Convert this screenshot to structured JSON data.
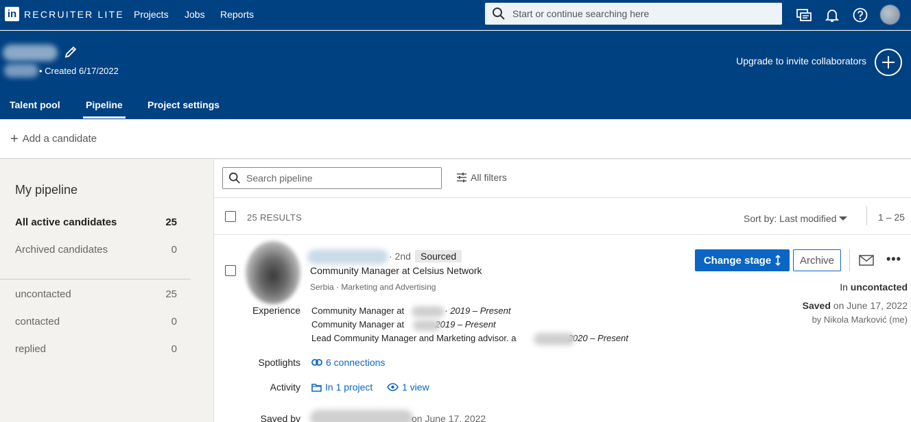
{
  "app": {
    "brand": "RECRUITER LITE",
    "logo_letters": "in"
  },
  "nav": {
    "links": [
      "Projects",
      "Jobs",
      "Reports"
    ],
    "search_placeholder": "Start or continue searching here"
  },
  "project": {
    "created": "• Created 6/17/2022",
    "upgrade_label": "Upgrade to invite collaborators",
    "tabs": [
      "Talent pool",
      "Pipeline",
      "Project settings"
    ],
    "active_tab": "Pipeline"
  },
  "add_candidate": "Add a candidate",
  "sidebar": {
    "title": "My pipeline",
    "rows": [
      {
        "label": "All active candidates",
        "count": "25"
      },
      {
        "label": "Archived candidates",
        "count": "0"
      },
      {
        "label": "uncontacted",
        "count": "25"
      },
      {
        "label": "contacted",
        "count": "0"
      },
      {
        "label": "replied",
        "count": "0"
      }
    ]
  },
  "main": {
    "search_placeholder": "Search pipeline",
    "filters_label": "All filters",
    "results": "25 RESULTS",
    "sort_label": "Sort by: Last modified",
    "range": "1 – 25"
  },
  "candidate": {
    "degree": "· 2nd",
    "status_badge": "Sourced",
    "headline": "Community Manager at Celsius Network",
    "subline": "Serbia · Marketing and Advertising",
    "experience_label": "Experience",
    "experience": [
      {
        "title": "Community Manager at",
        "dates": "· 2019 – Present"
      },
      {
        "title": "Community Manager at",
        "dates": "2019 – Present"
      },
      {
        "title": "Lead Community Manager and Marketing advisor. a",
        "dates": "2020 – Present"
      }
    ],
    "spotlights_label": "Spotlights",
    "spotlights_link": "6 connections",
    "activity_label": "Activity",
    "activity_project": "In 1 project",
    "activity_views": "1 view",
    "saved_by_label": "Saved by",
    "saved_by_date": "on June 17, 2022",
    "change_stage": "Change stage",
    "archive": "Archive",
    "stage_prefix": "In",
    "stage": "uncontacted",
    "saved_prefix": "Saved",
    "saved_date": "on June 17, 2022",
    "saved_by": "by Nikola Marković (me)"
  },
  "colors": {
    "brand_blue": "#004182",
    "accent_blue": "#0a66c2"
  }
}
